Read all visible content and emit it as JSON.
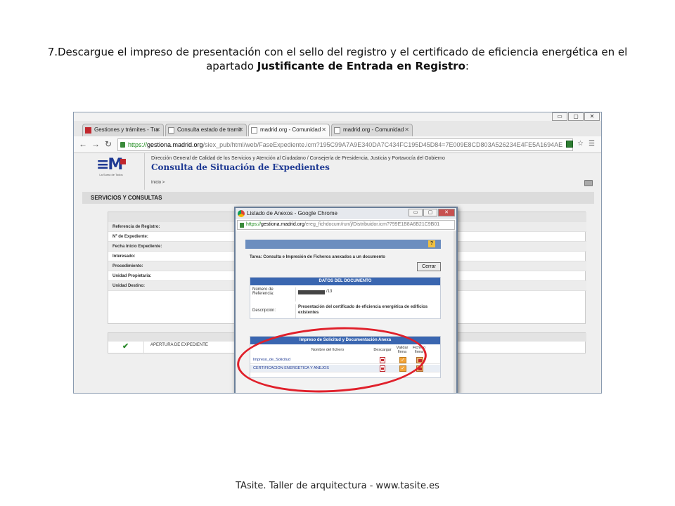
{
  "slide": {
    "title_prefix": "7.Descargue el impreso de presentación con el sello del registro y el certificado de eficiencia energética en el apartado ",
    "title_bold": "Justificante de Entrada en Registro",
    "title_suffix": ":",
    "footer": "TAsite. Taller de arquitectura - www.tasite.es"
  },
  "browser": {
    "window_controls": [
      "▭",
      "▢",
      "✕"
    ],
    "tabs": [
      {
        "label": "Gestiones y trámites - Tra",
        "active": false
      },
      {
        "label": "Consulta estado de tramit",
        "active": false
      },
      {
        "label": "madrid.org - Comunidad",
        "active": true
      },
      {
        "label": "madrid.org - Comunidad",
        "active": false
      }
    ],
    "url_scheme": "https://",
    "url_host": "gestiona.madrid.org",
    "url_path": "/siex_pub/html/web/FaseExpediente.icm?195C99A7A9E340DA7C434FC195D45D84=7E009E8CD803A526234E4FE5A1694AE"
  },
  "page": {
    "header_text": "Dirección General de Calidad de los Servicios y Atención al Ciudadano / Consejería de Presidencia, Justicia y Portavocía del Gobierno",
    "title": "Consulta de Situación de Expedientes",
    "breadcrumb": "Inicio >",
    "logo_caption": "La Suma de Todos",
    "section_title": "SERVICIOS Y CONSULTAS",
    "fields": [
      "Referencia de Registro:",
      "Nº de Expediente:",
      "Fecha Inicio Expediente:",
      "Interesado:",
      "Procedimiento:",
      "Unidad Propietaria:",
      "Unidad Destino:"
    ],
    "status_row": "APERTURA DE EXPEDIENTE"
  },
  "popup": {
    "title": "Listado de Anexos - Google Chrome",
    "url_scheme": "https://",
    "url_host": "gestiona.madrid.org",
    "url_path": "/ereg_fichdocum/run/j/Distribuidor.icm?799E1B8A6B21C9B01",
    "help": "?",
    "tarea": "Tarea:  Consulta e Impresión de Ficheros anexados a un documento",
    "close_button": "Cerrar",
    "document": {
      "header": "DATOS DEL DOCUMENTO",
      "ref_label": "Número de Referencia:",
      "ref_suffix": "/13",
      "desc_label": "Descripción:",
      "desc_value": "Presentación del certificado de eficiencia energética de edificios existentes"
    },
    "files": {
      "header": "Impreso de Solicitud y Documentación Anexa",
      "col_name": "Nombre del fichero",
      "col_download": "Descargar",
      "col_validate": "Validar firma",
      "col_signed": "Fichero firma",
      "rows": [
        {
          "name": "Impreso_de_Solicitud"
        },
        {
          "name": "CERTIFICACION ENERGETICA Y ANEJOS"
        }
      ]
    }
  },
  "colors": {
    "annotation": "#e0202b",
    "brand_blue": "#1f3a93",
    "table_header": "#3a66b0"
  }
}
